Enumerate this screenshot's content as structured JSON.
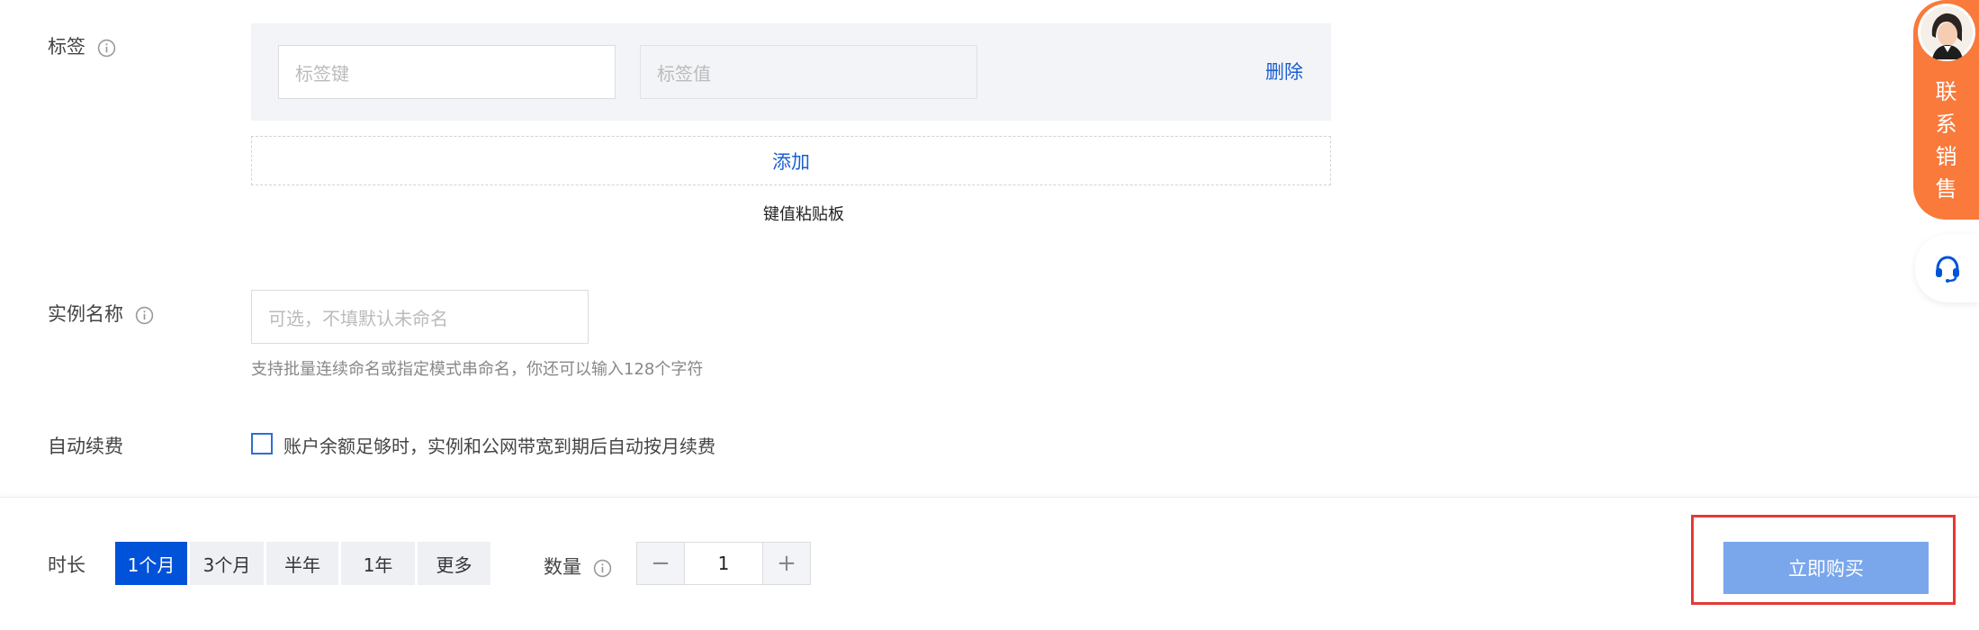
{
  "tags": {
    "label": "标签",
    "key_placeholder": "标签键",
    "value_placeholder": "标签值",
    "delete_label": "删除",
    "add_label": "添加",
    "paste_label": "键值粘贴板"
  },
  "instance_name": {
    "label": "实例名称",
    "placeholder": "可选，不填默认未命名",
    "hint": "支持批量连续命名或指定模式串命名，你还可以输入128个字符"
  },
  "auto_renew": {
    "label": "自动续费",
    "checkbox_text": "账户余额足够时，实例和公网带宽到期后自动按月续费"
  },
  "footer": {
    "duration_label": "时长",
    "durations": [
      "1个月",
      "3个月",
      "半年",
      "1年",
      "更多"
    ],
    "selected_duration": "1个月",
    "quantity_label": "数量",
    "quantity_value": "1",
    "buy_label": "立即购买"
  },
  "sidebar": {
    "contact_sales_label": "联系销售"
  },
  "colors": {
    "primary": "#0052d9",
    "link": "#1a5fd1",
    "buy_button": "#7aa6ec",
    "highlight_box": "#e53935",
    "sales_orange": "#f97a3a"
  }
}
